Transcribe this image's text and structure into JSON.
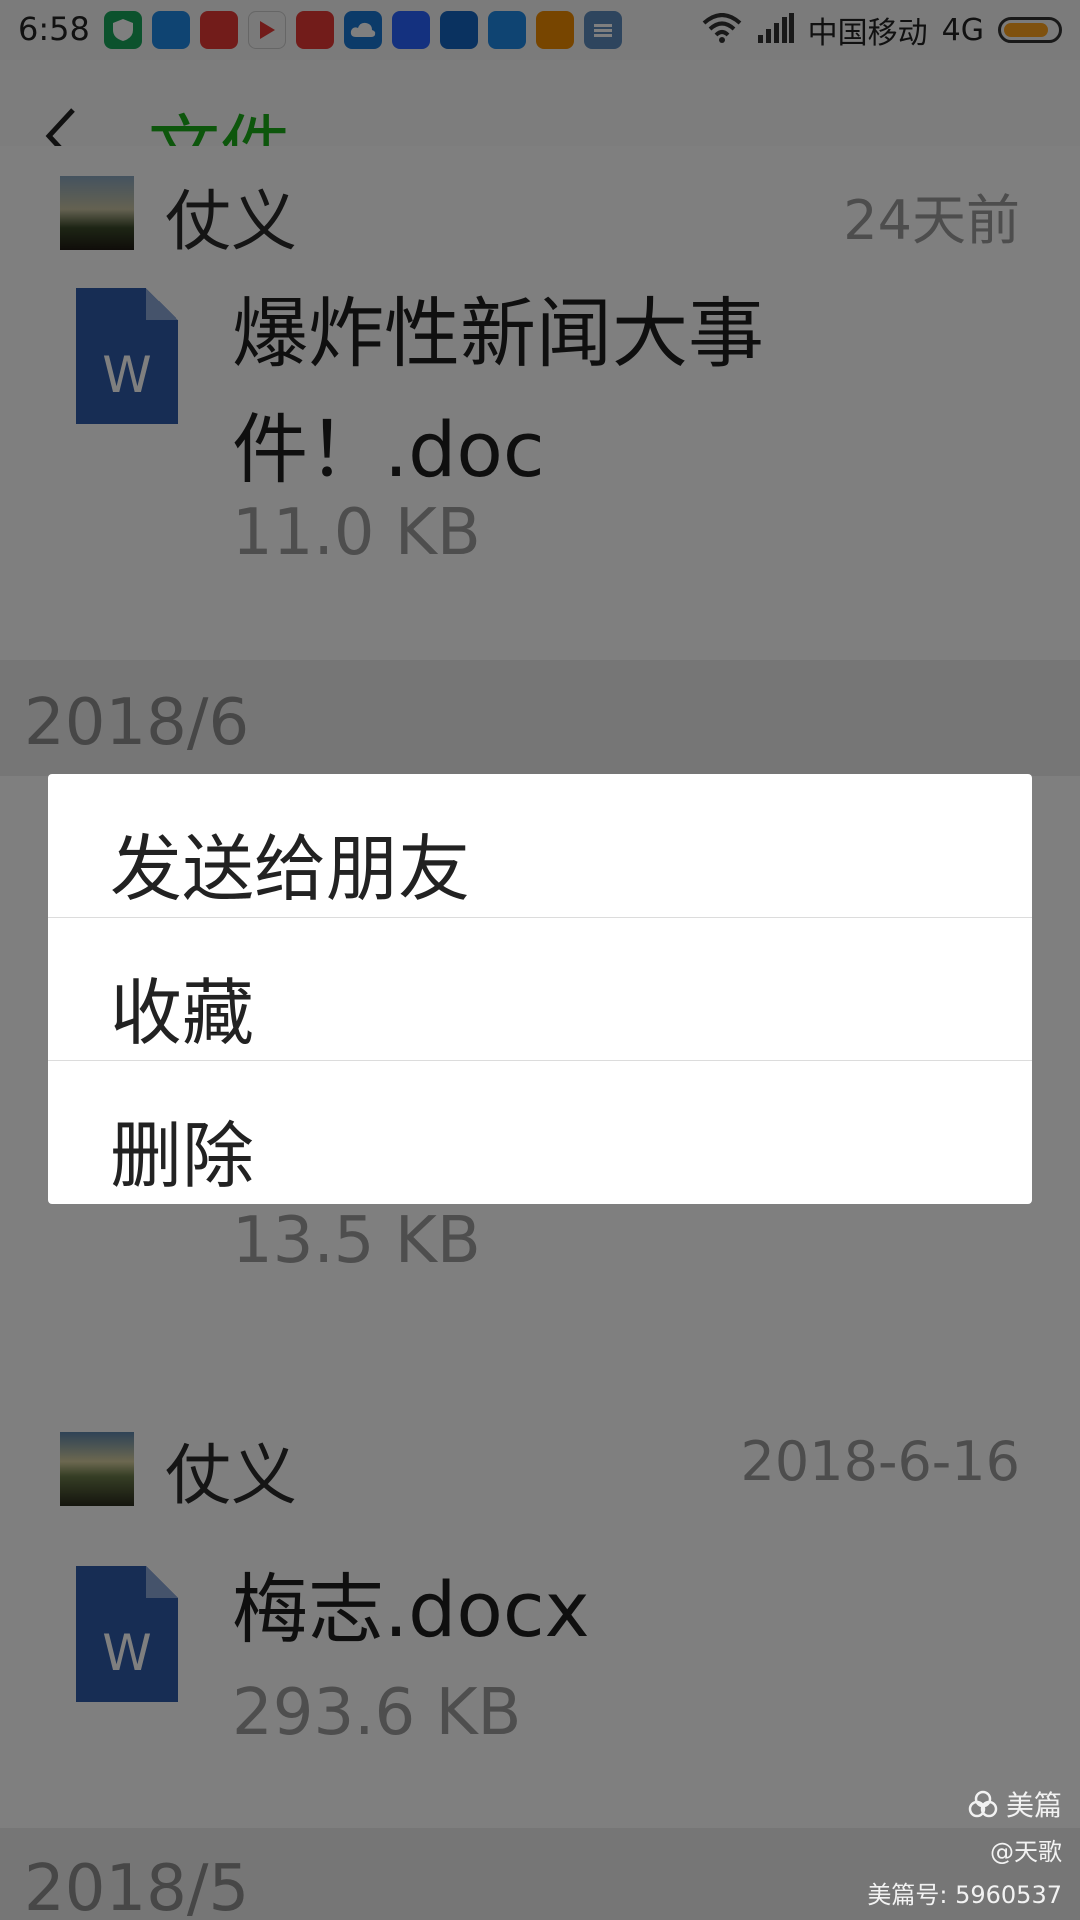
{
  "status_bar": {
    "time": "6:58",
    "carrier": "中国移动",
    "network": "4G",
    "notification_icons": [
      "shield-icon",
      "blue-app-icon",
      "red-promo-icon",
      "play-store-icon",
      "red-promo-icon",
      "cloud-icon",
      "blue-app-icon",
      "blue-app-icon",
      "blue-app-icon",
      "100-promo-icon",
      "list-icon"
    ],
    "battery_level": 0.85
  },
  "header": {
    "title": "文件",
    "accent_color": "#1aad19"
  },
  "files": [
    {
      "sender": "仗义",
      "date": "24天前",
      "name": "爆炸性新闻大事件！.doc",
      "size": "11.0 KB",
      "icon_letter": "W"
    },
    {
      "size": "13.5 KB"
    },
    {
      "sender": "仗义",
      "date": "2018-6-16",
      "name": "梅志.docx",
      "size": "293.6 KB",
      "icon_letter": "W"
    }
  ],
  "sections": {
    "month_1": "2018/6",
    "month_2": "2018/5"
  },
  "context_menu": {
    "items": [
      "发送给朋友",
      "收藏",
      "删除"
    ]
  },
  "watermark": {
    "brand": "美篇",
    "author": "@天歌",
    "id_text": "美篇号: 5960537"
  }
}
